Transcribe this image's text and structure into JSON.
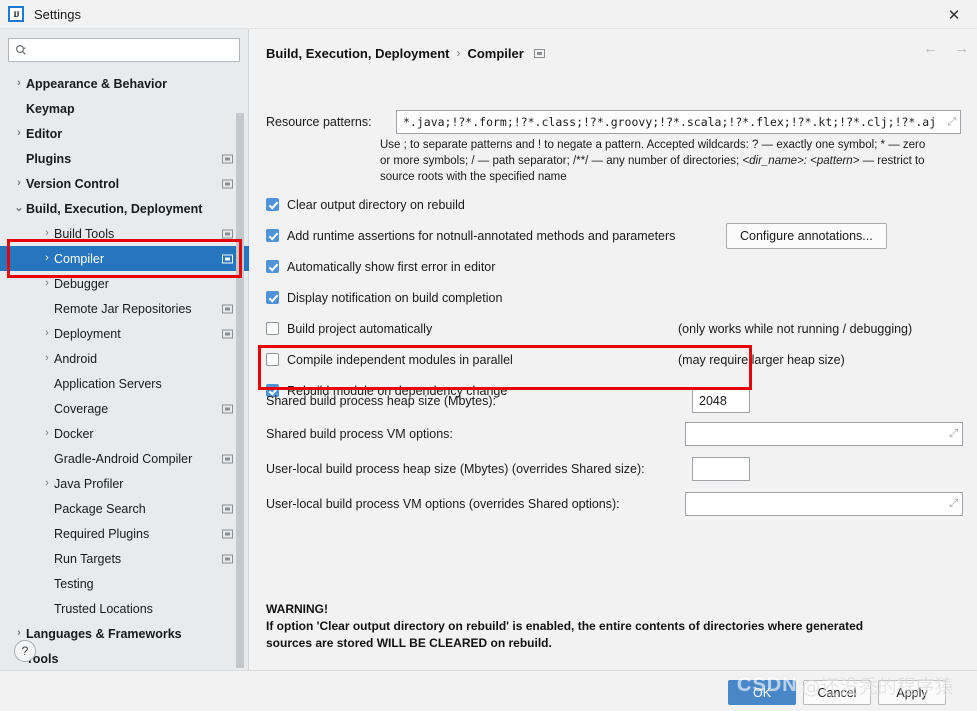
{
  "window": {
    "title": "Settings",
    "logo_text": "IJ",
    "close_label": "✕"
  },
  "sidebar": {
    "search": {
      "value": "",
      "placeholder": ""
    },
    "items": [
      {
        "label": "Appearance & Behavior",
        "indent": 0,
        "twisty": "›",
        "bold": true,
        "badge": false,
        "selected": false
      },
      {
        "label": "Keymap",
        "indent": 0,
        "twisty": "",
        "bold": true,
        "badge": false,
        "selected": false
      },
      {
        "label": "Editor",
        "indent": 0,
        "twisty": "›",
        "bold": true,
        "badge": false,
        "selected": false
      },
      {
        "label": "Plugins",
        "indent": 0,
        "twisty": "",
        "bold": true,
        "badge": true,
        "selected": false
      },
      {
        "label": "Version Control",
        "indent": 0,
        "twisty": "›",
        "bold": true,
        "badge": true,
        "selected": false
      },
      {
        "label": "Build, Execution, Deployment",
        "indent": 0,
        "twisty": "⌄",
        "bold": true,
        "badge": false,
        "selected": false
      },
      {
        "label": "Build Tools",
        "indent": 1,
        "twisty": "›",
        "bold": false,
        "badge": true,
        "selected": false
      },
      {
        "label": "Compiler",
        "indent": 1,
        "twisty": "›",
        "bold": false,
        "badge": true,
        "selected": true
      },
      {
        "label": "Debugger",
        "indent": 1,
        "twisty": "›",
        "bold": false,
        "badge": false,
        "selected": false
      },
      {
        "label": "Remote Jar Repositories",
        "indent": 1,
        "twisty": "",
        "bold": false,
        "badge": true,
        "selected": false
      },
      {
        "label": "Deployment",
        "indent": 1,
        "twisty": "›",
        "bold": false,
        "badge": true,
        "selected": false
      },
      {
        "label": "Android",
        "indent": 1,
        "twisty": "›",
        "bold": false,
        "badge": false,
        "selected": false
      },
      {
        "label": "Application Servers",
        "indent": 1,
        "twisty": "",
        "bold": false,
        "badge": false,
        "selected": false
      },
      {
        "label": "Coverage",
        "indent": 1,
        "twisty": "",
        "bold": false,
        "badge": true,
        "selected": false
      },
      {
        "label": "Docker",
        "indent": 1,
        "twisty": "›",
        "bold": false,
        "badge": false,
        "selected": false
      },
      {
        "label": "Gradle-Android Compiler",
        "indent": 1,
        "twisty": "",
        "bold": false,
        "badge": true,
        "selected": false
      },
      {
        "label": "Java Profiler",
        "indent": 1,
        "twisty": "›",
        "bold": false,
        "badge": false,
        "selected": false
      },
      {
        "label": "Package Search",
        "indent": 1,
        "twisty": "",
        "bold": false,
        "badge": true,
        "selected": false
      },
      {
        "label": "Required Plugins",
        "indent": 1,
        "twisty": "",
        "bold": false,
        "badge": true,
        "selected": false
      },
      {
        "label": "Run Targets",
        "indent": 1,
        "twisty": "",
        "bold": false,
        "badge": true,
        "selected": false
      },
      {
        "label": "Testing",
        "indent": 1,
        "twisty": "",
        "bold": false,
        "badge": false,
        "selected": false
      },
      {
        "label": "Trusted Locations",
        "indent": 1,
        "twisty": "",
        "bold": false,
        "badge": false,
        "selected": false
      },
      {
        "label": "Languages & Frameworks",
        "indent": 0,
        "twisty": "›",
        "bold": true,
        "badge": false,
        "selected": false
      },
      {
        "label": "Tools",
        "indent": 0,
        "twisty": "›",
        "bold": true,
        "badge": false,
        "selected": false
      }
    ],
    "help_label": "?"
  },
  "header": {
    "crumb_parent": "Build, Execution, Deployment",
    "crumb_sep": "›",
    "crumb_current": "Compiler",
    "back_arrow": "←",
    "forward_arrow": "→"
  },
  "main": {
    "resource_patterns": {
      "label": "Resource patterns:",
      "value": "*.java;!?*.form;!?*.class;!?*.groovy;!?*.scala;!?*.flex;!?*.kt;!?*.clj;!?*.aj",
      "expand_icon": "⤢"
    },
    "hint_line1": "Use ; to separate patterns and ! to negate a pattern. Accepted wildcards: ? — exactly one symbol; * — zero",
    "hint_line2_a": "or more symbols; / — path separator; /**/ — any number of directories; ",
    "hint_line2_i": "<dir_name>: <pattern>",
    "hint_line2_b": " — restrict to",
    "hint_line3": "source roots with the specified name",
    "checkboxes": [
      {
        "label": "Clear output directory on rebuild",
        "checked": true,
        "note": ""
      },
      {
        "label": "Add runtime assertions for notnull-annotated methods and parameters",
        "checked": true,
        "note": ""
      },
      {
        "label": "Automatically show first error in editor",
        "checked": true,
        "note": ""
      },
      {
        "label": "Display notification on build completion",
        "checked": true,
        "note": ""
      },
      {
        "label": "Build project automatically",
        "checked": false,
        "note": "(only works while not running / debugging)"
      },
      {
        "label": "Compile independent modules in parallel",
        "checked": false,
        "note": "(may require larger heap size)"
      },
      {
        "label": "Rebuild module on dependency change",
        "checked": true,
        "note": ""
      }
    ],
    "configure_annotations_button": "Configure annotations...",
    "fields": [
      {
        "label": "Shared build process heap size (Mbytes):",
        "value": "2048",
        "size": "small"
      },
      {
        "label": "Shared build process VM options:",
        "value": "",
        "size": "large"
      },
      {
        "label": "User-local build process heap size (Mbytes) (overrides Shared size):",
        "value": "",
        "size": "small"
      },
      {
        "label": "User-local build process VM options (overrides Shared options):",
        "value": "",
        "size": "large"
      }
    ],
    "warning_title": "WARNING!",
    "warning_line1": "If option 'Clear output directory on rebuild' is enabled, the entire contents of directories where generated",
    "warning_line2": "sources are stored WILL BE CLEARED on rebuild."
  },
  "footer": {
    "ok_label": "OK",
    "cancel_label": "Cancel",
    "apply_label": "Apply"
  },
  "watermark": {
    "logo": "CSDN",
    "text": "@还没秃的程序猿"
  },
  "colors": {
    "selection_blue": "#2675bf",
    "checkbox_blue": "#4f93d9",
    "annotation_red": "#e60000",
    "ok_button_blue": "#4a87c8",
    "sidebar_bg": "#e7ebee",
    "panel_bg": "#f2f2f2"
  }
}
